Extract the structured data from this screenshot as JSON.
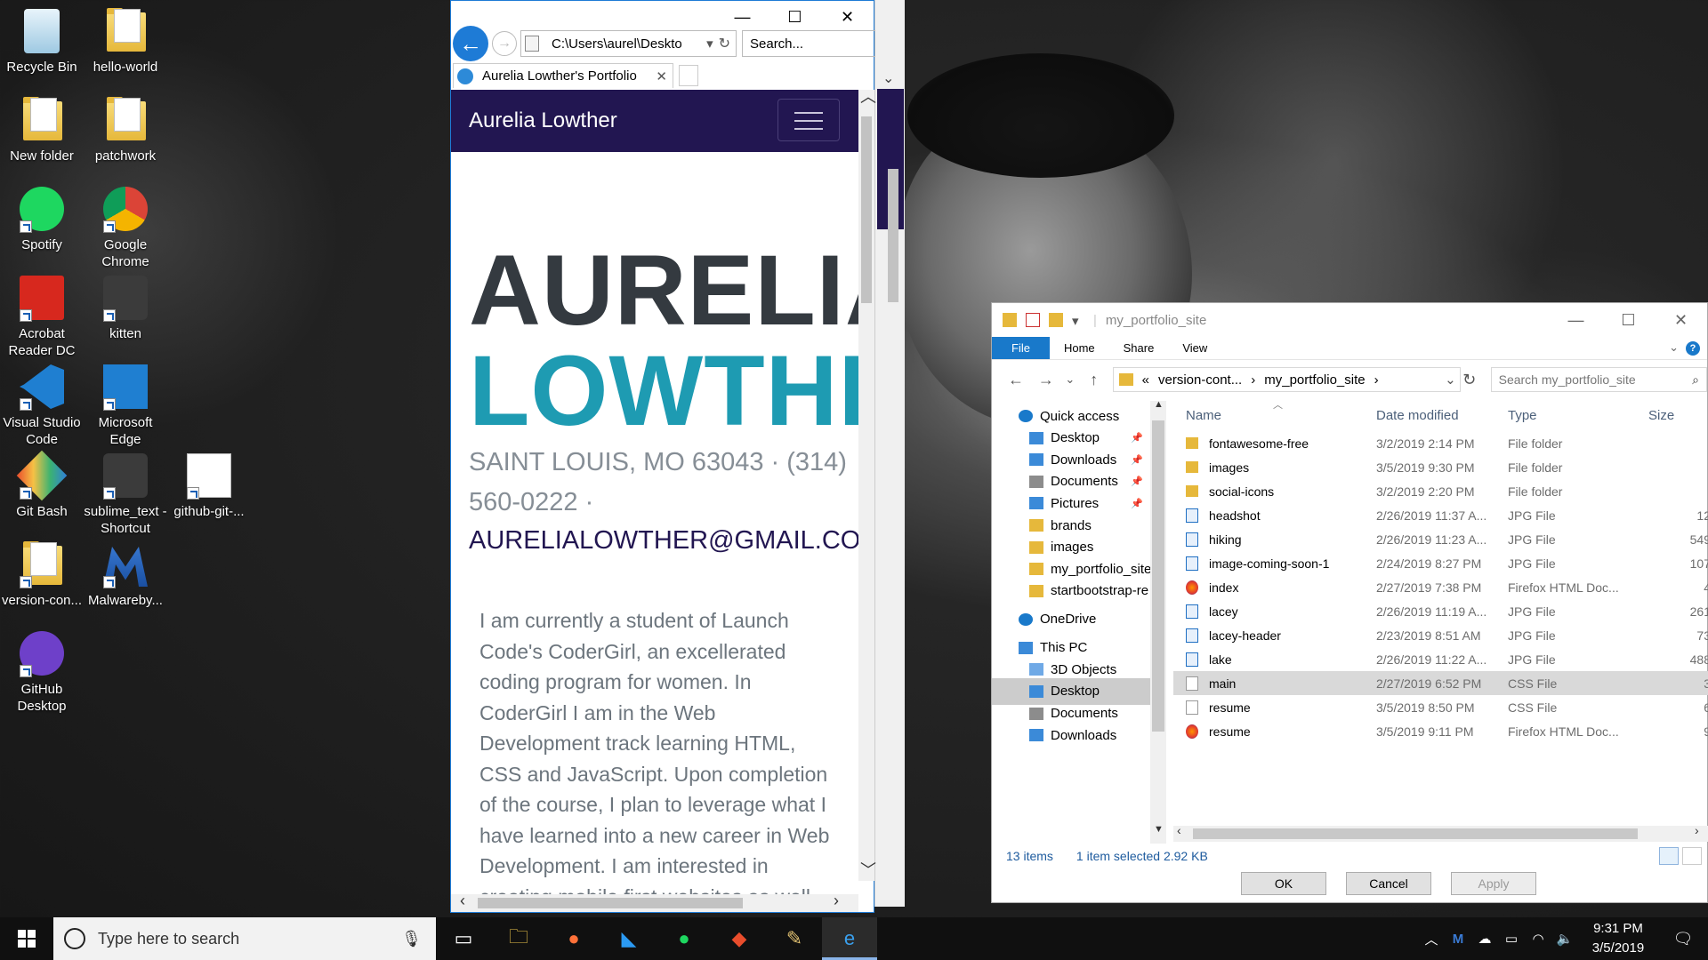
{
  "desktop": {
    "icons": [
      {
        "label": "Recycle Bin",
        "icon": "recycle-bin-icon"
      },
      {
        "label": "hello-world",
        "icon": "folder-icon"
      },
      {
        "label": "New folder",
        "icon": "folder-icon"
      },
      {
        "label": "patchwork",
        "icon": "folder-icon"
      },
      {
        "label": "Spotify",
        "icon": "spotify-icon"
      },
      {
        "label": "Google Chrome",
        "icon": "chrome-icon"
      },
      {
        "label": "Acrobat Reader DC",
        "icon": "acrobat-icon"
      },
      {
        "label": "kitten",
        "icon": "sublime-icon"
      },
      {
        "label": "Visual Studio Code",
        "icon": "vscode-icon"
      },
      {
        "label": "Microsoft Edge",
        "icon": "edge-icon"
      },
      {
        "label": "Git Bash",
        "icon": "git-icon"
      },
      {
        "label": "sublime_text - Shortcut",
        "icon": "sublime-icon"
      },
      {
        "label": "github-git-...",
        "icon": "pdf-icon"
      },
      {
        "label": "version-con...",
        "icon": "folder-icon"
      },
      {
        "label": "Malwareby...",
        "icon": "malwarebytes-icon"
      },
      {
        "label": "GitHub Desktop",
        "icon": "github-desktop-icon"
      }
    ]
  },
  "browser": {
    "address": "C:\\Users\\aurel\\Deskto",
    "search_placeholder": "Search...",
    "tab_title": "Aurelia Lowther's Portfolio",
    "tab_close": "✕",
    "window_controls": {
      "minimize": "—",
      "maximize": "☐",
      "close": "✕"
    },
    "page": {
      "brand": "Aurelia Lowther",
      "name_first": "AURELIA",
      "name_last": "LOWTHER",
      "address_line": "SAINT LOUIS, MO 63043 · (314) 560-0222 ·",
      "email": "AURELIALOWTHER@GMAIL.COM",
      "bio": "I am currently a student of Launch Code's CoderGirl, an excellerated coding program for women. In CoderGirl I am in the Web Development track learning HTML, CSS and JavaScript. Upon completion of the course, I plan to leverage what I have learned into a new career in Web Development. I am interested in creating mobile first websites as well.",
      "colors": {
        "nav": "#221651",
        "accent": "#1e9bb2",
        "heading": "#343a40"
      }
    }
  },
  "explorer": {
    "title": "my_portfolio_site",
    "ribbon_tabs": [
      "File",
      "Home",
      "Share",
      "View"
    ],
    "help": "?",
    "breadcrumb": [
      "«",
      "version-cont...",
      "›",
      "my_portfolio_site",
      "›"
    ],
    "search_placeholder": "Search my_portfolio_site",
    "tree": [
      {
        "label": "Quick access",
        "icon": "star-icon",
        "indent": 0,
        "pin": false
      },
      {
        "label": "Desktop",
        "icon": "desktop-icon",
        "indent": 1,
        "pin": true
      },
      {
        "label": "Downloads",
        "icon": "downloads-icon",
        "indent": 1,
        "pin": true
      },
      {
        "label": "Documents",
        "icon": "documents-icon",
        "indent": 1,
        "pin": true
      },
      {
        "label": "Pictures",
        "icon": "pictures-icon",
        "indent": 1,
        "pin": true
      },
      {
        "label": "brands",
        "icon": "folder-icon",
        "indent": 1,
        "pin": false
      },
      {
        "label": "images",
        "icon": "folder-icon",
        "indent": 1,
        "pin": false
      },
      {
        "label": "my_portfolio_site",
        "icon": "folder-icon",
        "indent": 1,
        "pin": false
      },
      {
        "label": "startbootstrap-re",
        "icon": "folder-icon",
        "indent": 1,
        "pin": false
      },
      {
        "label": "OneDrive",
        "icon": "onedrive-icon",
        "indent": 0,
        "pin": false
      },
      {
        "label": "This PC",
        "icon": "pc-icon",
        "indent": 0,
        "pin": false
      },
      {
        "label": "3D Objects",
        "icon": "3d-objects-icon",
        "indent": 1,
        "pin": false
      },
      {
        "label": "Desktop",
        "icon": "desktop-icon",
        "indent": 1,
        "pin": false,
        "selected": true
      },
      {
        "label": "Documents",
        "icon": "documents-icon",
        "indent": 1,
        "pin": false
      },
      {
        "label": "Downloads",
        "icon": "downloads-icon",
        "indent": 1,
        "pin": false
      }
    ],
    "columns": [
      "Name",
      "Date modified",
      "Type",
      "Size"
    ],
    "files": [
      {
        "name": "fontawesome-free",
        "date": "3/2/2019 2:14 PM",
        "type": "File folder",
        "size": "",
        "kind": "folder"
      },
      {
        "name": "images",
        "date": "3/5/2019 9:30 PM",
        "type": "File folder",
        "size": "",
        "kind": "folder"
      },
      {
        "name": "social-icons",
        "date": "3/2/2019 2:20 PM",
        "type": "File folder",
        "size": "",
        "kind": "folder"
      },
      {
        "name": "headshot",
        "date": "2/26/2019 11:37 A...",
        "type": "JPG File",
        "size": "12",
        "kind": "jpg"
      },
      {
        "name": "hiking",
        "date": "2/26/2019 11:23 A...",
        "type": "JPG File",
        "size": "549",
        "kind": "jpg"
      },
      {
        "name": "image-coming-soon-1",
        "date": "2/24/2019 8:27 PM",
        "type": "JPG File",
        "size": "107",
        "kind": "jpg"
      },
      {
        "name": "index",
        "date": "2/27/2019 7:38 PM",
        "type": "Firefox HTML Doc...",
        "size": "4",
        "kind": "ff"
      },
      {
        "name": "lacey",
        "date": "2/26/2019 11:19 A...",
        "type": "JPG File",
        "size": "261",
        "kind": "jpg"
      },
      {
        "name": "lacey-header",
        "date": "2/23/2019 8:51 AM",
        "type": "JPG File",
        "size": "73",
        "kind": "jpg"
      },
      {
        "name": "lake",
        "date": "2/26/2019 11:22 A...",
        "type": "JPG File",
        "size": "488",
        "kind": "jpg"
      },
      {
        "name": "main",
        "date": "2/27/2019 6:52 PM",
        "type": "CSS File",
        "size": "3",
        "kind": "css",
        "selected": true
      },
      {
        "name": "resume",
        "date": "3/5/2019 8:50 PM",
        "type": "CSS File",
        "size": "6",
        "kind": "css"
      },
      {
        "name": "resume",
        "date": "3/5/2019 9:11 PM",
        "type": "Firefox HTML Doc...",
        "size": "9",
        "kind": "ff"
      }
    ],
    "status_count": "13 items",
    "status_selected": "1 item selected  2.92 KB",
    "buttons": {
      "ok": "OK",
      "cancel": "Cancel",
      "apply": "Apply"
    }
  },
  "taskbar": {
    "search_placeholder": "Type here to search",
    "apps": [
      "task-view-icon",
      "file-explorer-icon",
      "firefox-icon",
      "vscode-icon",
      "spotify-icon",
      "git-icon",
      "paint-icon",
      "internet-explorer-icon"
    ],
    "time": "9:31 PM",
    "date": "3/5/2019"
  }
}
